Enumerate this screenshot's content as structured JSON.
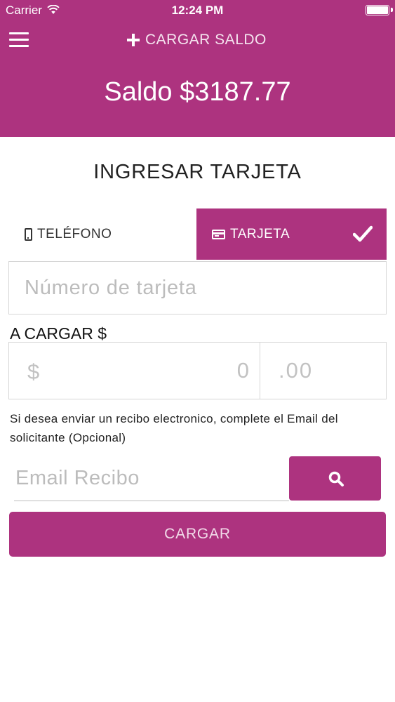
{
  "status_bar": {
    "carrier": "Carrier",
    "time": "12:24 PM"
  },
  "header": {
    "menu_icon": "hamburger-menu-icon",
    "topup_icon": "plus-icon",
    "topup_label": "CARGAR SALDO",
    "balance": "Saldo $3187.77"
  },
  "form": {
    "title": "INGRESAR TARJETA",
    "tabs": [
      {
        "label": "TELÉFONO",
        "icon": "phone-icon",
        "selected": false
      },
      {
        "label": "TARJETA",
        "icon": "credit-card-icon",
        "selected": true
      }
    ],
    "card_number_placeholder": "Número de tarjeta",
    "amount_label": "A CARGAR $",
    "currency_symbol": "$",
    "amount_int_placeholder": "0",
    "amount_dec_placeholder": ".00",
    "receipt_note": "Si desea enviar un recibo electronico, complete el Email del solicitante (Opcional)",
    "email_placeholder": "Email Recibo",
    "search_icon": "search-icon",
    "submit_label": "CARGAR"
  },
  "colors": {
    "accent": "#ad337f",
    "white": "#ffffff",
    "border": "#d6d6d6",
    "placeholder": "#bcbcbc"
  }
}
